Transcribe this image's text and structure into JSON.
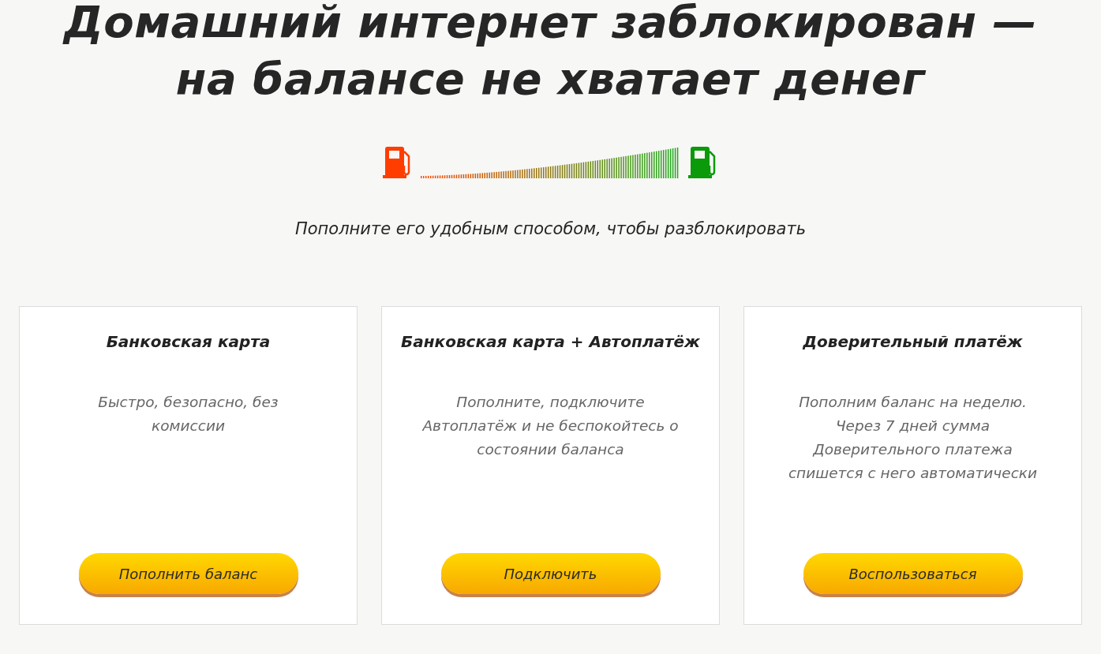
{
  "title": "Домашний интернет заблокирован — на балансе не хватает денег",
  "subtitle": "Пополните его удобным способом, чтобы разблокировать",
  "cards": [
    {
      "title": "Банковская карта",
      "description": "Быстро, безопасно, без комиссии",
      "button": "Пополнить баланс"
    },
    {
      "title": "Банковская карта + Автоплатёж",
      "description": "Пополните, подключите Автоплатёж и не беспокойтесь о состоянии баланса",
      "button": "Подключить"
    },
    {
      "title": "Доверительный платёж",
      "description": "Пополним баланс на неделю. Через 7 дней сумма Доверительного платежа спишется с него автоматически",
      "button": "Воспользоваться"
    }
  ]
}
